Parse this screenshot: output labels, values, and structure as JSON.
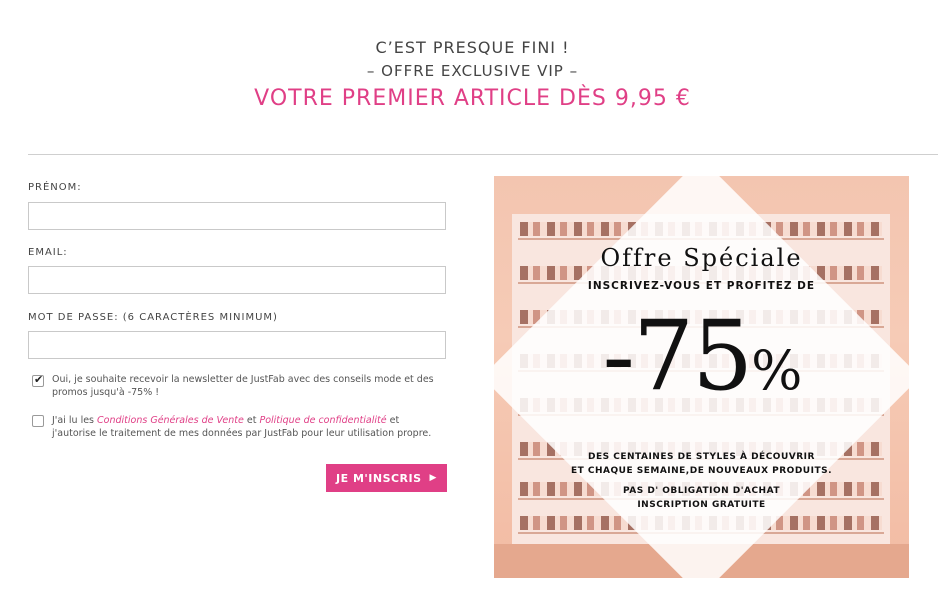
{
  "header": {
    "line1": "C’EST PRESQUE FINI !",
    "line2": "– OFFRE EXCLUSIVE VIP –",
    "line3": "VOTRE PREMIER ARTICLE DÈS 9,95 €"
  },
  "form": {
    "firstname_label": "PRÉNOM:",
    "firstname_value": "",
    "email_label": "EMAIL:",
    "email_value": "",
    "password_label": "MOT DE PASSE: (6 CARACTÈRES MINIMUM)",
    "password_value": "",
    "newsletter_checked": true,
    "newsletter_text": "Oui, je souhaite recevoir la newsletter de JustFab avec des conseils mode et des promos jusqu'à -75% !",
    "terms_checked": false,
    "terms_prefix": "J'ai lu les ",
    "terms_link1": "Conditions Générales de Vente",
    "terms_middle": " et ",
    "terms_link2": "Politique de confidentialité",
    "terms_suffix": " et j'autorise le traitement de mes données par JustFab pour leur utilisation propre.",
    "submit_label": "JE M'INSCRIS",
    "submit_icon": "caret-right-icon"
  },
  "promo": {
    "title": "Offre Spéciale",
    "subtitle": "INSCRIVEZ-VOUS ET PROFITEZ DE",
    "discount": "-75",
    "percent": "%",
    "desc_line1": "DES CENTAINES DE STYLES À DÉCOUVRIR",
    "desc_line2": "ET CHAQUE SEMAINE,DE NOUVEAUX PRODUITS.",
    "desc_line3": "PAS D' OBLIGATION D'ACHAT",
    "desc_line4": "INSCRIPTION GRATUITE"
  },
  "colors": {
    "accent": "#e03f86",
    "text": "#444444",
    "promo_bg": "#f3c5b0"
  }
}
